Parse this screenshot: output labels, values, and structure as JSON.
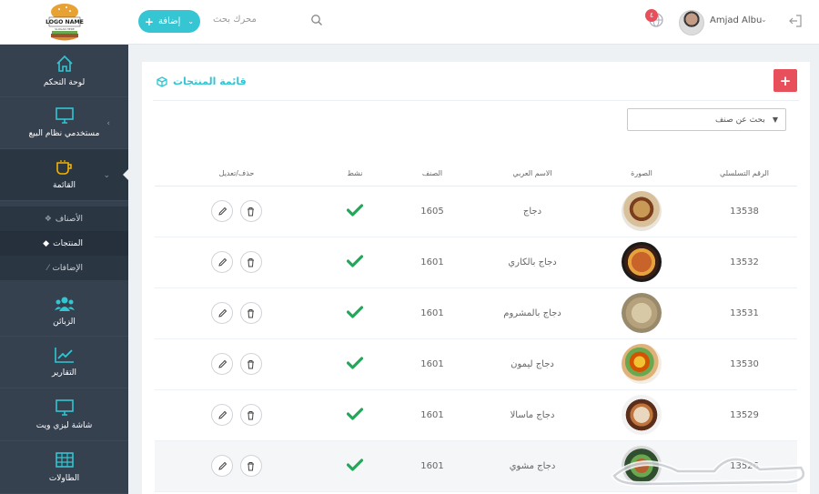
{
  "logo": {
    "line1": "LOGO NAME",
    "line2": "SLOGAN HERE"
  },
  "topbar": {
    "add_label": "إضافة",
    "search_placeholder": "محرك بحث",
    "notification_count": "٤",
    "user_name": "Amjad Albu"
  },
  "sidebar": {
    "items": [
      {
        "label": "لوحة التحكم",
        "icon": "home-icon"
      },
      {
        "label": "مستخدمي نظام البيع",
        "icon": "monitor-icon"
      },
      {
        "label": "القائمة",
        "icon": "cup-icon"
      },
      {
        "label": "الزبائن",
        "icon": "users-icon"
      },
      {
        "label": "التقارير",
        "icon": "chart-icon"
      },
      {
        "label": "شاشة ليزي ويت",
        "icon": "display-icon"
      },
      {
        "label": "الطاولات",
        "icon": "table-icon"
      }
    ],
    "subitems": [
      {
        "label": "الأصناف",
        "icon": "cubes-icon"
      },
      {
        "label": "المنتجات",
        "icon": "cube-icon"
      },
      {
        "label": "الإضافات",
        "icon": "magic-icon"
      }
    ]
  },
  "card": {
    "title": "قائمة المنتجات",
    "filter_label": "بحث عن صنف"
  },
  "table": {
    "headers": {
      "actions": "حذف/تعديل",
      "active": "نشط",
      "category": "الصنف",
      "arabic_name": "الاسم العربي",
      "image": "الصورة",
      "serial": "الرقم التسلسلي"
    },
    "rows": [
      {
        "category": "1605",
        "name": "دجاج",
        "serial": "13538",
        "photo": "burger"
      },
      {
        "category": "1601",
        "name": "دجاج بالكاري",
        "serial": "13532",
        "photo": "curry"
      },
      {
        "category": "1601",
        "name": "دجاج بالمشروم",
        "serial": "13531",
        "photo": "mushroom"
      },
      {
        "category": "1601",
        "name": "دجاج ليمون",
        "serial": "13530",
        "photo": "lemon"
      },
      {
        "category": "1601",
        "name": "دجاج ماسالا",
        "serial": "13529",
        "photo": "masala"
      },
      {
        "category": "1601",
        "name": "دجاج مشوي",
        "serial": "13526",
        "photo": "grilled"
      }
    ]
  },
  "colors": {
    "accent": "#36c6d3",
    "danger": "#e7505a",
    "sidebar": "#364150",
    "check": "#26a65b"
  }
}
